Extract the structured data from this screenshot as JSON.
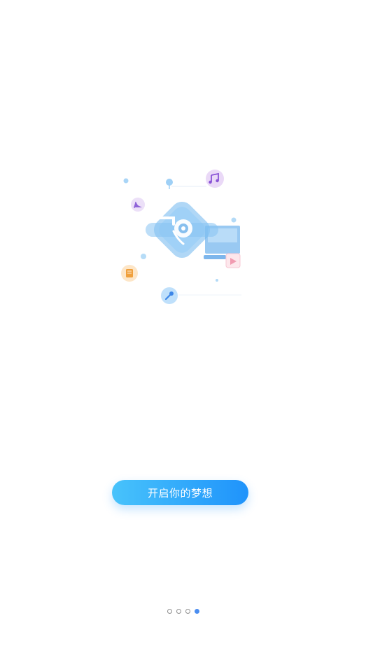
{
  "onboarding": {
    "start_button_label": "开启你的梦想",
    "page_count": 4,
    "current_page": 4
  },
  "illustration": {
    "icons": [
      "music-note-icon",
      "high-heel-icon",
      "book-icon",
      "microphone-icon",
      "video-card-icon",
      "gramophone-icon",
      "monitor-icon"
    ]
  },
  "colors": {
    "button_gradient_start": "#48c3fb",
    "button_gradient_end": "#1f93fb",
    "indicator_active": "#4a8df0",
    "indicator_inactive": "#8f8f8f"
  }
}
